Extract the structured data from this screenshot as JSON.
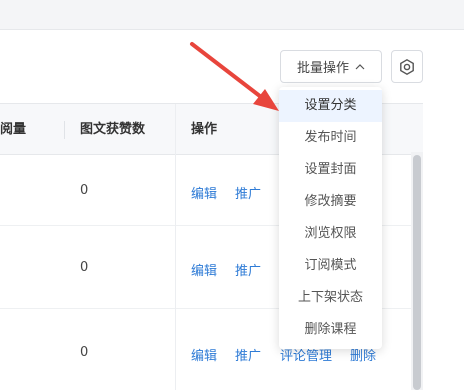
{
  "toolbar": {
    "batch_label": "批量操作",
    "settings_icon": "gear-icon"
  },
  "table": {
    "headers": {
      "read_count": "阅量",
      "like_count": "图文获赞数",
      "actions": "操作"
    },
    "rows": [
      {
        "likes": "0",
        "actions": [
          "编辑",
          "推广"
        ]
      },
      {
        "likes": "0",
        "actions": [
          "编辑",
          "推广"
        ]
      },
      {
        "likes": "0",
        "actions": [
          "编辑",
          "推广",
          "评论管理",
          "删除"
        ]
      }
    ]
  },
  "dropdown": {
    "items": [
      "设置分类",
      "发布时间",
      "设置封面",
      "修改摘要",
      "浏览权限",
      "订阅模式",
      "上下架状态",
      "删除课程"
    ],
    "active_index": 0
  },
  "colors": {
    "link": "#2e7bd6",
    "annotation_arrow": "#e8453c",
    "active_item_bg": "#edf4ff"
  }
}
